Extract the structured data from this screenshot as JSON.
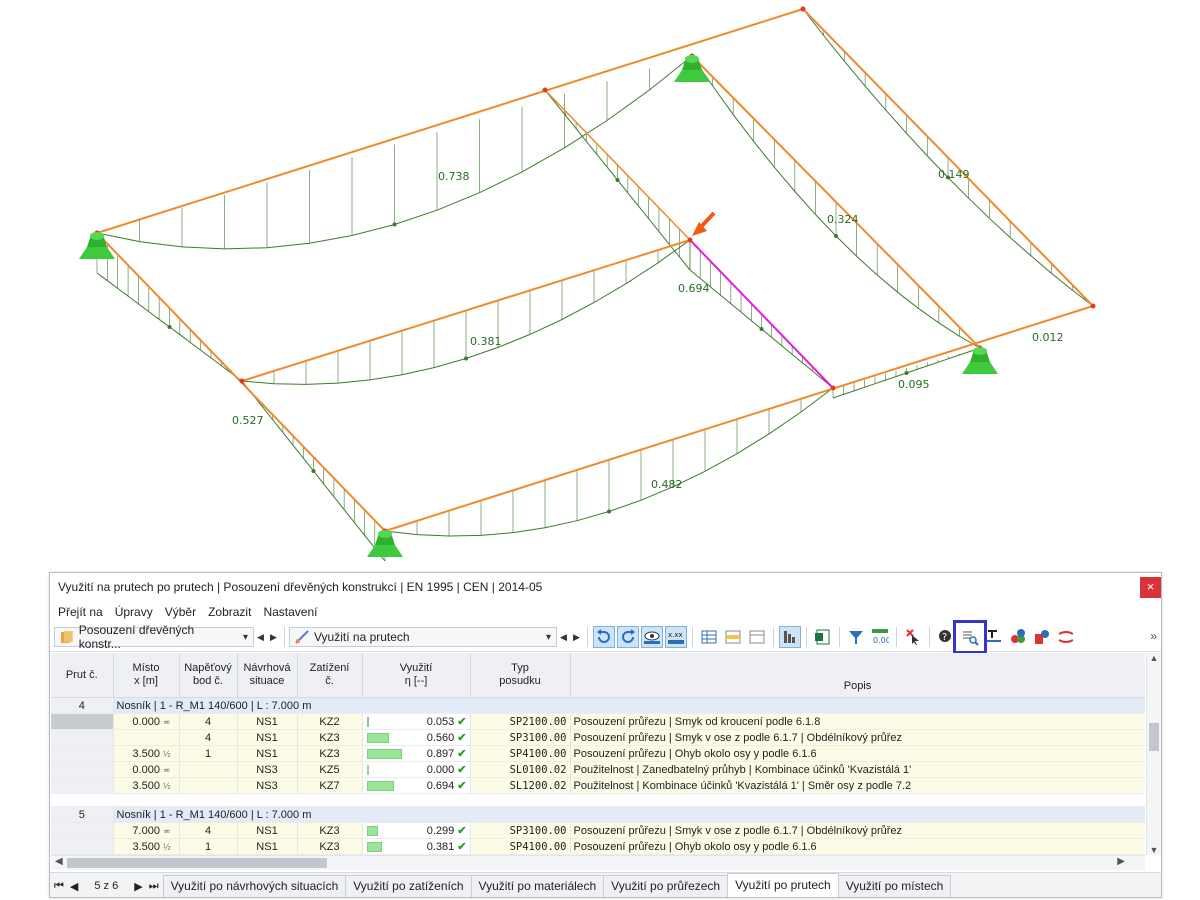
{
  "labels": {
    "v1": "0.738",
    "v2": "0.149",
    "v3": "0.324",
    "v4": "0.694",
    "v5": "0.381",
    "v6": "0.012",
    "v7": "0.095",
    "v8": "0.527",
    "v9": "0.482"
  },
  "colors": {
    "member": "#f08a2e",
    "selected_member": "#e01ee0",
    "diagram": "#3d7a2e",
    "support": "#3ec93e",
    "arrow": "#f05a14"
  },
  "panel": {
    "title": "Využití na prutech po prutech | Posouzení dřevěných konstrukcí | EN 1995 | CEN | 2014-05",
    "close": "×",
    "menu": [
      "Přejít na",
      "Úpravy",
      "Výběr",
      "Zobrazit",
      "Nastavení"
    ],
    "combo1": "Posouzení dřevěných konstr...",
    "combo2": "Využití na prutech",
    "more": "»",
    "icons": [
      "refresh-left-icon",
      "refresh-right-icon",
      "view-eye-icon",
      "decimals-icon",
      "table-icon",
      "table-highlight-icon",
      "table-plain-icon",
      "column-chart-icon",
      "excel-export-icon",
      "filter-icon",
      "number-format-icon",
      "deselect-icon",
      "help-icon",
      "detail-search-icon",
      "text-format-icon",
      "info-badge-icon",
      "member-info-icon",
      "diagram-icon"
    ]
  },
  "table": {
    "headers": {
      "prut": "Prut č.",
      "misto": "Místo\nx [m]",
      "bod": "Napěťový\nbod č.",
      "situace": "Návrhová\nsituace",
      "zatizeni": "Zatížení\nč.",
      "vyuziti": "Využití\nη [--]",
      "typ": "Typ\nposudku",
      "popis": "Popis"
    },
    "groups": [
      {
        "member_no": "4",
        "title": "Nosník | 1 - R_M1 140/600 | L : 7.000 m",
        "rows": [
          {
            "x": "0.000",
            "sym": "≖",
            "bod": "4",
            "sit": "NS1",
            "zat": "KZ2",
            "eta": "0.053",
            "frac": 0.053,
            "typ": "SP2100.00",
            "popis": "Posouzení průřezu | Smyk od kroucení podle 6.1.8"
          },
          {
            "x": "",
            "sym": "",
            "bod": "4",
            "sit": "NS1",
            "zat": "KZ3",
            "eta": "0.560",
            "frac": 0.56,
            "typ": "SP3100.00",
            "popis": "Posouzení průřezu | Smyk v ose z podle 6.1.7 | Obdélníkový průřez"
          },
          {
            "x": "3.500",
            "sym": "½",
            "bod": "1",
            "sit": "NS1",
            "zat": "KZ3",
            "eta": "0.897",
            "frac": 0.897,
            "typ": "SP4100.00",
            "popis": "Posouzení průřezu | Ohyb okolo osy y podle 6.1.6"
          },
          {
            "x": "0.000",
            "sym": "≖",
            "bod": "",
            "sit": "NS3",
            "zat": "KZ5",
            "eta": "0.000",
            "frac": 0.0,
            "typ": "SL0100.02",
            "popis": "Použitelnost | Zanedbatelný průhyb | Kombinace účinků 'Kvazistálá 1'"
          },
          {
            "x": "3.500",
            "sym": "½",
            "bod": "",
            "sit": "NS3",
            "zat": "KZ7",
            "eta": "0.694",
            "frac": 0.694,
            "typ": "SL1200.02",
            "popis": "Použitelnost | Kombinace účinků 'Kvazistálá 1' | Směr osy z podle 7.2"
          }
        ]
      },
      {
        "member_no": "5",
        "title": "Nosník | 1 - R_M1 140/600 | L : 7.000 m",
        "rows": [
          {
            "x": "7.000",
            "sym": "≖",
            "bod": "4",
            "sit": "NS1",
            "zat": "KZ3",
            "eta": "0.299",
            "frac": 0.299,
            "typ": "SP3100.00",
            "popis": "Posouzení průřezu | Smyk v ose z podle 6.1.7 | Obdélníkový průřez"
          },
          {
            "x": "3.500",
            "sym": "½",
            "bod": "1",
            "sit": "NS1",
            "zat": "KZ3",
            "eta": "0.381",
            "frac": 0.381,
            "typ": "SP4100.00",
            "popis": "Posouzení průřezu | Ohyb okolo osy y podle 6.1.6"
          }
        ]
      }
    ]
  },
  "footer": {
    "pager": "5 z 6",
    "first": "⏮",
    "prev": "◀",
    "next": "▶",
    "last": "⏭",
    "tabs": [
      "Využití po návrhových situacích",
      "Využití po zatíženích",
      "Využití po materiálech",
      "Využití po průřezech",
      "Využití po prutech",
      "Využití po místech"
    ],
    "active_tab": 4
  }
}
